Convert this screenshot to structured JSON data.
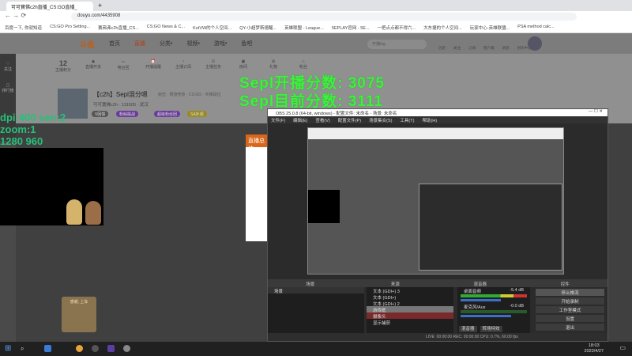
{
  "browser": {
    "tab_title": "可可寶佛c2h直播_CS:GO直播_",
    "url": "douyu.com/4435908",
    "bookmarks": [
      "百度一下, 你就知道",
      "CS:GO Pro Setting...",
      "賽弗弗c2h直播_CS...",
      "CS:GO News & C...",
      "KotVW的个人空间...",
      "QY-小超梦斯德醒...",
      "英雄联盟 - League...",
      "5EPLAY官网 - 5E...",
      "一把点点都不得六...",
      "大东捷的个人空间...",
      "玩家中心-英雄联盟...",
      "PSA method calc..."
    ]
  },
  "site": {
    "logo": "斗鱼",
    "nav": [
      "首页",
      "直播",
      "分类•",
      "视频•",
      "游戏•",
      "鱼吧"
    ],
    "search_placeholder": "开播ing",
    "user_icons": [
      "历史",
      "关注",
      "订阅",
      "客户端",
      "消息",
      "创作中心"
    ],
    "sidebar": [
      "关注",
      "排行榜"
    ],
    "toolbar": [
      "12",
      "直播开关",
      "电台回",
      "开播提醒",
      "主播订阅",
      "主播任务",
      "房间",
      "礼物",
      "粉丝"
    ],
    "toolbar_caption": "主播积分",
    "room_title": "【c2h】Sepl混分嗯",
    "room_meta": "可可寶佛c2h · 131505 · 武汉",
    "room_category": "射击 · 网游竞技 · CS:GO · 天梯段位",
    "pills": [
      "V回馈",
      "粉絲挑战",
      "超级粉丝团",
      "SA外观"
    ],
    "popup_header": "直播总结",
    "gift_label": "感谢, 上车"
  },
  "overlay": {
    "score_start": "Sepl开播分数: 3075",
    "score_now": "Sepl目前分数: 3111",
    "settings": [
      "dpi:400 sen:2",
      "zoom:1",
      "1280 960"
    ]
  },
  "obs": {
    "title": "OBS 25.0.8 (64-bit, windows) - 配置文件: 未命名 - 场景: 未命名",
    "menu": [
      "文件(F)",
      "编辑(E)",
      "查看(V)",
      "配置文件(P)",
      "场景集合(S)",
      "工具(T)",
      "帮助(H)"
    ],
    "docks": [
      "场景",
      "来源",
      "混音器",
      "控件"
    ],
    "scenes": [
      "场景"
    ],
    "sources": [
      "文本 (GDI+) 3",
      "文本 (GDI+)",
      "文本 (GDI+) 2",
      "游戏框",
      "摄像头",
      "显示捕获"
    ],
    "mixer": [
      {
        "name": "桌面音频",
        "db": "-5.4 dB",
        "level": 0.85
      },
      {
        "name": "麦克风/Aux",
        "db": "-0.0 dB",
        "level": 0.7
      }
    ],
    "mixer_tabs": [
      "混音器",
      "转场特效"
    ],
    "controls": [
      "停止推流",
      "开始录制",
      "工作室模式",
      "设置",
      "退出"
    ],
    "status": "LIVE: 00:00:00   REC: 00:00:00   CPU: 0.7%, 60.00 fps"
  },
  "taskbar": {
    "time": "18:03",
    "date": "2022/4/27"
  }
}
